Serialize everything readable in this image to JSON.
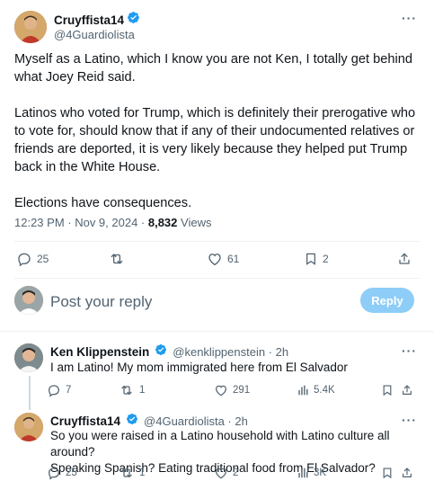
{
  "tweet": {
    "author_name": "Cruyffista14",
    "author_handle": "@4Guardiolista",
    "more_label": "···",
    "paragraphs": [
      "Myself as a Latino, which I know you are not Ken, I totally get behind what Joey Reid said.",
      "Latinos who voted for Trump, which is definitely their prerogative who to vote for, should know that if any of their undocumented relatives or friends are deported, it is very likely because they helped put Trump back in the White House.",
      "Elections have consequences."
    ],
    "timestamp": "12:23 PM · Nov 9, 2024 · ",
    "views_count": "8,832",
    "views_label": " Views",
    "stats": {
      "replies": "25",
      "reposts": "",
      "likes": "61",
      "bookmarks": "2"
    }
  },
  "composer": {
    "placeholder": "Post your reply",
    "button_label": "Reply"
  },
  "replies": [
    {
      "author_name": "Ken Klippenstein",
      "author_handle": "@kenklippenstein · 2h",
      "text": "I am Latino! My mom immigrated here from El Salvador",
      "stats": {
        "replies": "7",
        "reposts": "1",
        "likes": "291",
        "views": "5.4K"
      }
    },
    {
      "author_name": "Cruyffista14",
      "author_handle": "@4Guardiolista · 2h",
      "text_lines": [
        "So you were raised in a Latino household with Latino culture all around?",
        "Speaking Spanish? Eating traditional food from El Salvador?"
      ],
      "stats": {
        "replies": "25",
        "reposts": "1",
        "likes": "2",
        "views": "3K"
      }
    }
  ],
  "colors": {
    "verified": "#1d9bf0",
    "text_secondary": "#536471",
    "reply_button": "#8ecdf7"
  }
}
